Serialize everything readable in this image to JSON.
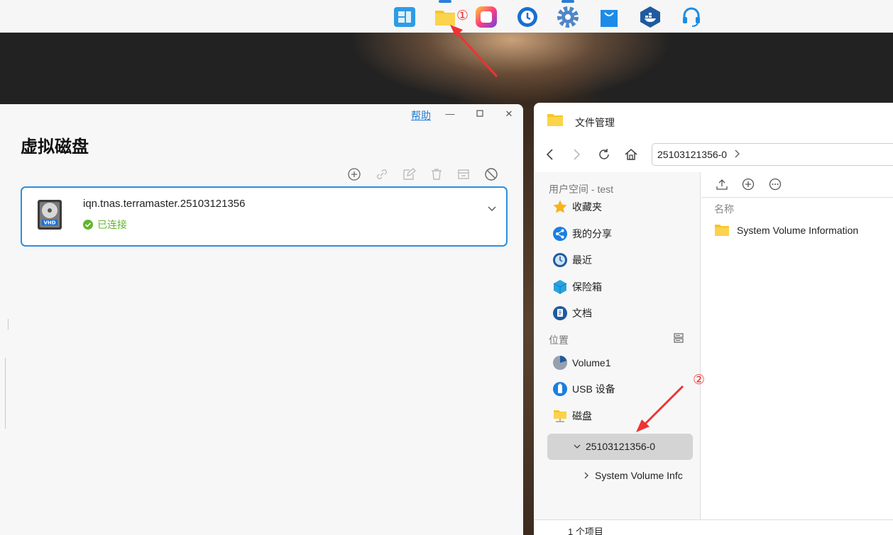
{
  "dock": {
    "icons": [
      "control-panel-icon",
      "file-manager-icon",
      "app-center-icon",
      "backup-icon",
      "settings-icon",
      "store-icon",
      "docker-icon",
      "support-icon"
    ],
    "annotation_1": "①",
    "annotation_2": "②"
  },
  "virtual_disk": {
    "help": "帮助",
    "title": "虚拟磁盘",
    "disk_name": "iqn.tnas.terramaster.25103121356",
    "status": "已连接",
    "vhd_label": "VHD"
  },
  "file_manager": {
    "title": "文件管理",
    "path": "25103121356-0",
    "user_space_header": "用户空间 - test",
    "user_items": [
      "收藏夹",
      "我的分享",
      "最近",
      "保险箱",
      "文档"
    ],
    "location_header": "位置",
    "location_items": [
      "Volume1",
      "USB 设备",
      "磁盘"
    ],
    "selected_disk": "25103121356-0",
    "child_folder": "System Volume Infc",
    "column_name": "名称",
    "file_row": "System Volume Information",
    "footer": "1 个项目"
  },
  "colors": {
    "accent": "#2b8fe0",
    "success": "#63b52f",
    "annotation": "#e33333",
    "folder": "#f8c521"
  }
}
